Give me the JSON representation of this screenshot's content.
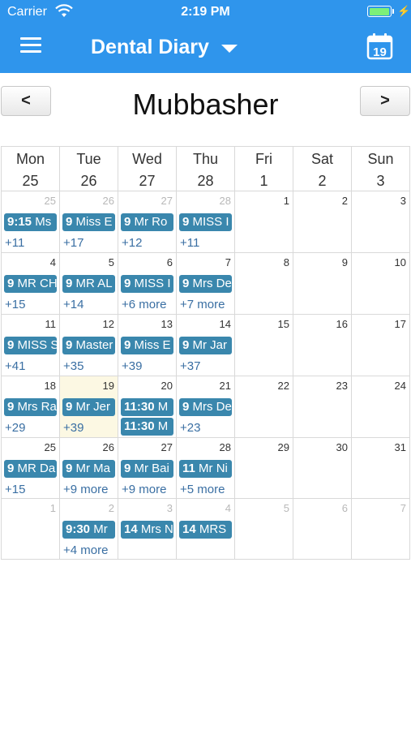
{
  "status": {
    "carrier": "Carrier",
    "time": "2:19 PM",
    "battery_level": 1.0
  },
  "header": {
    "title": "Dental Diary",
    "calendar_icon_day": "19"
  },
  "nav": {
    "prev": "<",
    "next": ">",
    "person": "Mubbasher"
  },
  "weekdays": [
    {
      "name": "Mon",
      "date": "25"
    },
    {
      "name": "Tue",
      "date": "26"
    },
    {
      "name": "Wed",
      "date": "27"
    },
    {
      "name": "Thu",
      "date": "28"
    },
    {
      "name": "Fri",
      "date": "1"
    },
    {
      "name": "Sat",
      "date": "2"
    },
    {
      "name": "Sun",
      "date": "3"
    }
  ],
  "weeks": [
    [
      {
        "day": "25",
        "other": true,
        "events": [
          {
            "time": "9:15",
            "text": "Ms"
          }
        ],
        "more": "+11"
      },
      {
        "day": "26",
        "other": true,
        "events": [
          {
            "time": "9",
            "text": "Miss E"
          }
        ],
        "more": "+17"
      },
      {
        "day": "27",
        "other": true,
        "events": [
          {
            "time": "9",
            "text": "Mr Ro"
          }
        ],
        "more": "+12"
      },
      {
        "day": "28",
        "other": true,
        "events": [
          {
            "time": "9",
            "text": "MISS I"
          }
        ],
        "more": "+11"
      },
      {
        "day": "1",
        "events": []
      },
      {
        "day": "2",
        "events": []
      },
      {
        "day": "3",
        "events": []
      }
    ],
    [
      {
        "day": "4",
        "events": [
          {
            "time": "9",
            "text": "MR CH"
          }
        ],
        "more": "+15"
      },
      {
        "day": "5",
        "events": [
          {
            "time": "9",
            "text": "MR AL"
          }
        ],
        "more": "+14"
      },
      {
        "day": "6",
        "events": [
          {
            "time": "9",
            "text": "MISS I"
          }
        ],
        "more": "+6 more"
      },
      {
        "day": "7",
        "events": [
          {
            "time": "9",
            "text": "Mrs De"
          }
        ],
        "more": "+7 more"
      },
      {
        "day": "8",
        "events": []
      },
      {
        "day": "9",
        "events": []
      },
      {
        "day": "10",
        "events": []
      }
    ],
    [
      {
        "day": "11",
        "events": [
          {
            "time": "9",
            "text": "MISS S"
          }
        ],
        "more": "+41"
      },
      {
        "day": "12",
        "events": [
          {
            "time": "9",
            "text": "Master"
          }
        ],
        "more": "+35"
      },
      {
        "day": "13",
        "events": [
          {
            "time": "9",
            "text": "Miss E"
          }
        ],
        "more": "+39"
      },
      {
        "day": "14",
        "events": [
          {
            "time": "9",
            "text": "Mr Jar"
          }
        ],
        "more": "+37"
      },
      {
        "day": "15",
        "events": []
      },
      {
        "day": "16",
        "events": []
      },
      {
        "day": "17",
        "events": []
      }
    ],
    [
      {
        "day": "18",
        "events": [
          {
            "time": "9",
            "text": "Mrs Ra"
          }
        ],
        "more": "+29"
      },
      {
        "day": "19",
        "today": true,
        "events": [
          {
            "time": "9",
            "text": "Mr Jer"
          }
        ],
        "more": "+39"
      },
      {
        "day": "20",
        "events": [
          {
            "time": "11:30",
            "text": "M"
          },
          {
            "time": "11:30",
            "text": "M"
          }
        ]
      },
      {
        "day": "21",
        "events": [
          {
            "time": "9",
            "text": "Mrs De"
          }
        ],
        "more": "+23"
      },
      {
        "day": "22",
        "events": []
      },
      {
        "day": "23",
        "events": []
      },
      {
        "day": "24",
        "events": []
      }
    ],
    [
      {
        "day": "25",
        "events": [
          {
            "time": "9",
            "text": "MR Da"
          }
        ],
        "more": "+15"
      },
      {
        "day": "26",
        "events": [
          {
            "time": "9",
            "text": "Mr Ma"
          }
        ],
        "more": "+9 more"
      },
      {
        "day": "27",
        "events": [
          {
            "time": "9",
            "text": "Mr Bai"
          }
        ],
        "more": "+9 more"
      },
      {
        "day": "28",
        "events": [
          {
            "time": "11",
            "text": "Mr Ni"
          }
        ],
        "more": "+5 more"
      },
      {
        "day": "29",
        "events": []
      },
      {
        "day": "30",
        "events": []
      },
      {
        "day": "31",
        "events": []
      }
    ],
    [
      {
        "day": "1",
        "other": true,
        "events": []
      },
      {
        "day": "2",
        "other": true,
        "events": [
          {
            "time": "9:30",
            "text": "Mr"
          }
        ],
        "more": "+4 more"
      },
      {
        "day": "3",
        "other": true,
        "events": [
          {
            "time": "14",
            "text": "Mrs N"
          }
        ]
      },
      {
        "day": "4",
        "other": true,
        "events": [
          {
            "time": "14",
            "text": "MRS"
          }
        ]
      },
      {
        "day": "5",
        "other": true,
        "events": []
      },
      {
        "day": "6",
        "other": true,
        "events": []
      },
      {
        "day": "7",
        "other": true,
        "events": []
      }
    ]
  ],
  "colors": {
    "header": "#2f95ec",
    "event": "#3a87ad",
    "today": "#fcf8e3",
    "more_link": "#3a6fa3"
  }
}
